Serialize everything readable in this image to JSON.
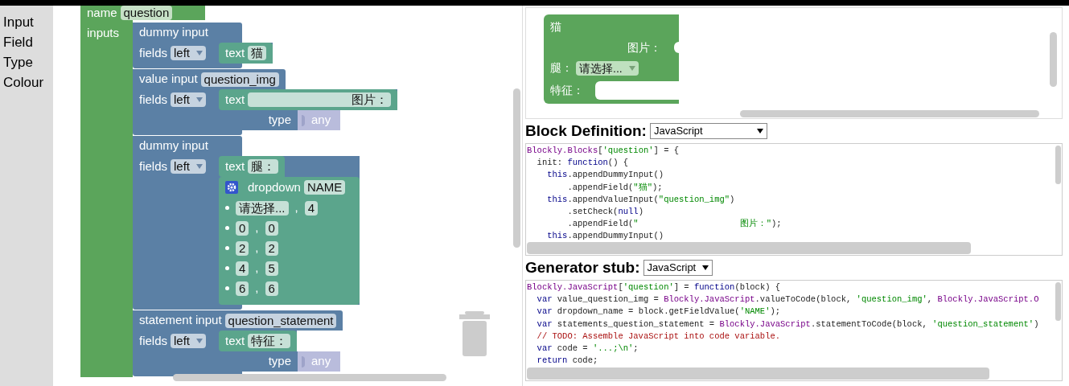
{
  "toolbox": {
    "categories": [
      "Input",
      "Field",
      "Type",
      "Colour"
    ]
  },
  "workspace": {
    "factory_block": {
      "name_label": "name",
      "name": "question",
      "inputs_label": "inputs",
      "inputs": [
        {
          "kind": "dummy",
          "label": "dummy input",
          "fields_label": "fields",
          "align": "left",
          "fields": [
            {
              "kind": "text",
              "label": "text",
              "value": "猫"
            }
          ]
        },
        {
          "kind": "value",
          "label": "value input",
          "name": "question_img",
          "fields_label": "fields",
          "align": "left",
          "fields": [
            {
              "kind": "text",
              "label": "text",
              "value": "                              图片："
            }
          ],
          "type_label": "type",
          "type": "any"
        },
        {
          "kind": "dummy",
          "label": "dummy input",
          "fields_label": "fields",
          "align": "left",
          "fields": [
            {
              "kind": "text",
              "label": "text",
              "value": "腿："
            },
            {
              "kind": "dropdown",
              "label": "dropdown",
              "name": "NAME",
              "separator": ",",
              "options": [
                {
                  "label": "请选择...",
                  "value": "4"
                },
                {
                  "label": "0",
                  "value": "0"
                },
                {
                  "label": "2",
                  "value": "2"
                },
                {
                  "label": "4",
                  "value": "5"
                },
                {
                  "label": "6",
                  "value": "6"
                }
              ]
            }
          ]
        },
        {
          "kind": "statement",
          "label": "statement input",
          "name": "question_statement",
          "fields_label": "fields",
          "align": "left",
          "fields": [
            {
              "kind": "text",
              "label": "text",
              "value": "特征："
            }
          ],
          "type_label": "type",
          "type": "any"
        }
      ]
    }
  },
  "preview": {
    "rows": [
      {
        "kind": "label",
        "text": "猫"
      },
      {
        "kind": "value",
        "text": "图片："
      },
      {
        "kind": "dropdown",
        "text": "腿：",
        "value": "请选择..."
      },
      {
        "kind": "statement",
        "text": "特征："
      }
    ]
  },
  "block_definition": {
    "title": "Block Definition:",
    "language": "JavaScript",
    "code": [
      [
        {
          "text": "Blockly.Blocks",
          "kind": "obj"
        },
        {
          "text": "[",
          "kind": "plain"
        },
        {
          "text": "'question'",
          "kind": "str"
        },
        {
          "text": "] = {",
          "kind": "plain"
        }
      ],
      [
        {
          "text": "  init: ",
          "kind": "plain"
        },
        {
          "text": "function",
          "kind": "kw"
        },
        {
          "text": "() {",
          "kind": "plain"
        }
      ],
      [
        {
          "text": "    this",
          "kind": "kw"
        },
        {
          "text": ".appendDummyInput()",
          "kind": "plain"
        }
      ],
      [
        {
          "text": "        .appendField(",
          "kind": "plain"
        },
        {
          "text": "\"猫\"",
          "kind": "str"
        },
        {
          "text": ");",
          "kind": "plain"
        }
      ],
      [
        {
          "text": "    this",
          "kind": "kw"
        },
        {
          "text": ".appendValueInput(",
          "kind": "plain"
        },
        {
          "text": "\"question_img\"",
          "kind": "str"
        },
        {
          "text": ")",
          "kind": "plain"
        }
      ],
      [
        {
          "text": "        .setCheck(",
          "kind": "plain"
        },
        {
          "text": "null",
          "kind": "kw"
        },
        {
          "text": ")",
          "kind": "plain"
        }
      ],
      [
        {
          "text": "        .appendField(",
          "kind": "plain"
        },
        {
          "text": "\"                    图片：\"",
          "kind": "str"
        },
        {
          "text": ");",
          "kind": "plain"
        }
      ],
      [
        {
          "text": "    this",
          "kind": "kw"
        },
        {
          "text": ".appendDummyInput()",
          "kind": "plain"
        }
      ]
    ]
  },
  "generator_stub": {
    "title": "Generator stub:",
    "language": "JavaScript",
    "code": [
      [
        {
          "text": "Blockly.JavaScript",
          "kind": "obj"
        },
        {
          "text": "[",
          "kind": "plain"
        },
        {
          "text": "'question'",
          "kind": "str"
        },
        {
          "text": "] = ",
          "kind": "plain"
        },
        {
          "text": "function",
          "kind": "kw"
        },
        {
          "text": "(block) {",
          "kind": "plain"
        }
      ],
      [
        {
          "text": "  var",
          "kind": "kw"
        },
        {
          "text": " value_question_img = ",
          "kind": "plain"
        },
        {
          "text": "Blockly.JavaScript",
          "kind": "obj"
        },
        {
          "text": ".valueToCode(block, ",
          "kind": "plain"
        },
        {
          "text": "'question_img'",
          "kind": "str"
        },
        {
          "text": ", ",
          "kind": "plain"
        },
        {
          "text": "Blockly.JavaScript.O",
          "kind": "obj"
        }
      ],
      [
        {
          "text": "  var",
          "kind": "kw"
        },
        {
          "text": " dropdown_name = block.getFieldValue(",
          "kind": "plain"
        },
        {
          "text": "'NAME'",
          "kind": "str"
        },
        {
          "text": ");",
          "kind": "plain"
        }
      ],
      [
        {
          "text": "  var",
          "kind": "kw"
        },
        {
          "text": " statements_question_statement = ",
          "kind": "plain"
        },
        {
          "text": "Blockly.JavaScript",
          "kind": "obj"
        },
        {
          "text": ".statementToCode(block, ",
          "kind": "plain"
        },
        {
          "text": "'question_statement'",
          "kind": "str"
        },
        {
          "text": ")",
          "kind": "plain"
        }
      ],
      [
        {
          "text": "  // TODO: Assemble JavaScript into code variable.",
          "kind": "com"
        }
      ],
      [
        {
          "text": "  var",
          "kind": "kw"
        },
        {
          "text": " code = ",
          "kind": "plain"
        },
        {
          "text": "'...;\\n'",
          "kind": "str"
        },
        {
          "text": ";",
          "kind": "plain"
        }
      ],
      [
        {
          "text": "  return",
          "kind": "kw"
        },
        {
          "text": " code;",
          "kind": "plain"
        }
      ]
    ]
  }
}
